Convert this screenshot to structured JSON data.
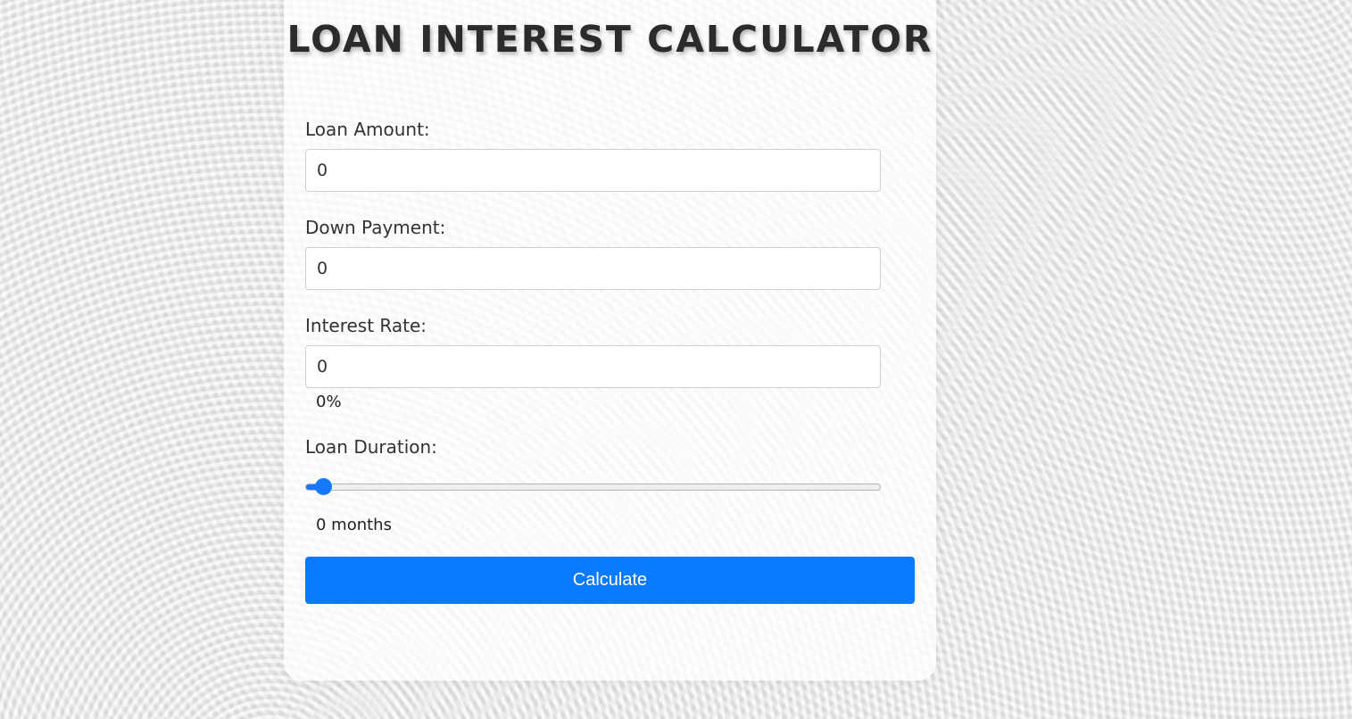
{
  "title": "LOAN INTEREST CALCULATOR",
  "form": {
    "loan_amount": {
      "label": "Loan Amount:",
      "value": "0"
    },
    "down_payment": {
      "label": "Down Payment:",
      "value": "0"
    },
    "interest_rate": {
      "label": "Interest Rate:",
      "value": "0",
      "display": "0%"
    },
    "loan_duration": {
      "label": "Loan Duration:",
      "slider_fraction": 0.03,
      "display": "0 months"
    },
    "calculate_label": "Calculate"
  },
  "colors": {
    "accent": "#0a7bff",
    "title_text": "#2b2b2b",
    "card_background": "#ffffff"
  }
}
